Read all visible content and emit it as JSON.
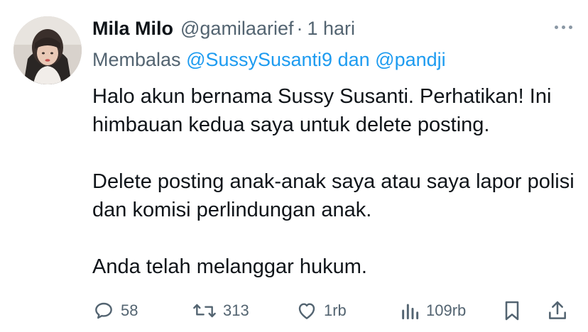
{
  "tweet": {
    "author_name": "Mila Milo",
    "handle": "@gamilaarief",
    "separator": "·",
    "time": "1 hari",
    "reply_prefix": "Membalas",
    "reply_to_1": "@SussySusanti9",
    "reply_conj": "dan",
    "reply_to_2": "@pandji",
    "paragraphs": [
      "Halo akun bernama Sussy Susanti. Perhatikan! Ini himbauan kedua saya untuk delete posting.",
      "Delete posting anak-anak saya atau saya lapor polisi dan komisi perlindungan anak.",
      "Anda telah melanggar hukum."
    ]
  },
  "actions": {
    "replies": "58",
    "retweets": "313",
    "likes": "1rb",
    "views": "109rb"
  },
  "icons": [
    "more-icon",
    "reply-icon",
    "retweet-icon",
    "like-icon",
    "views-icon",
    "bookmark-icon",
    "share-icon"
  ],
  "colors": {
    "text": "#0f1419",
    "secondary": "#536471",
    "link": "#1d9bf0"
  }
}
